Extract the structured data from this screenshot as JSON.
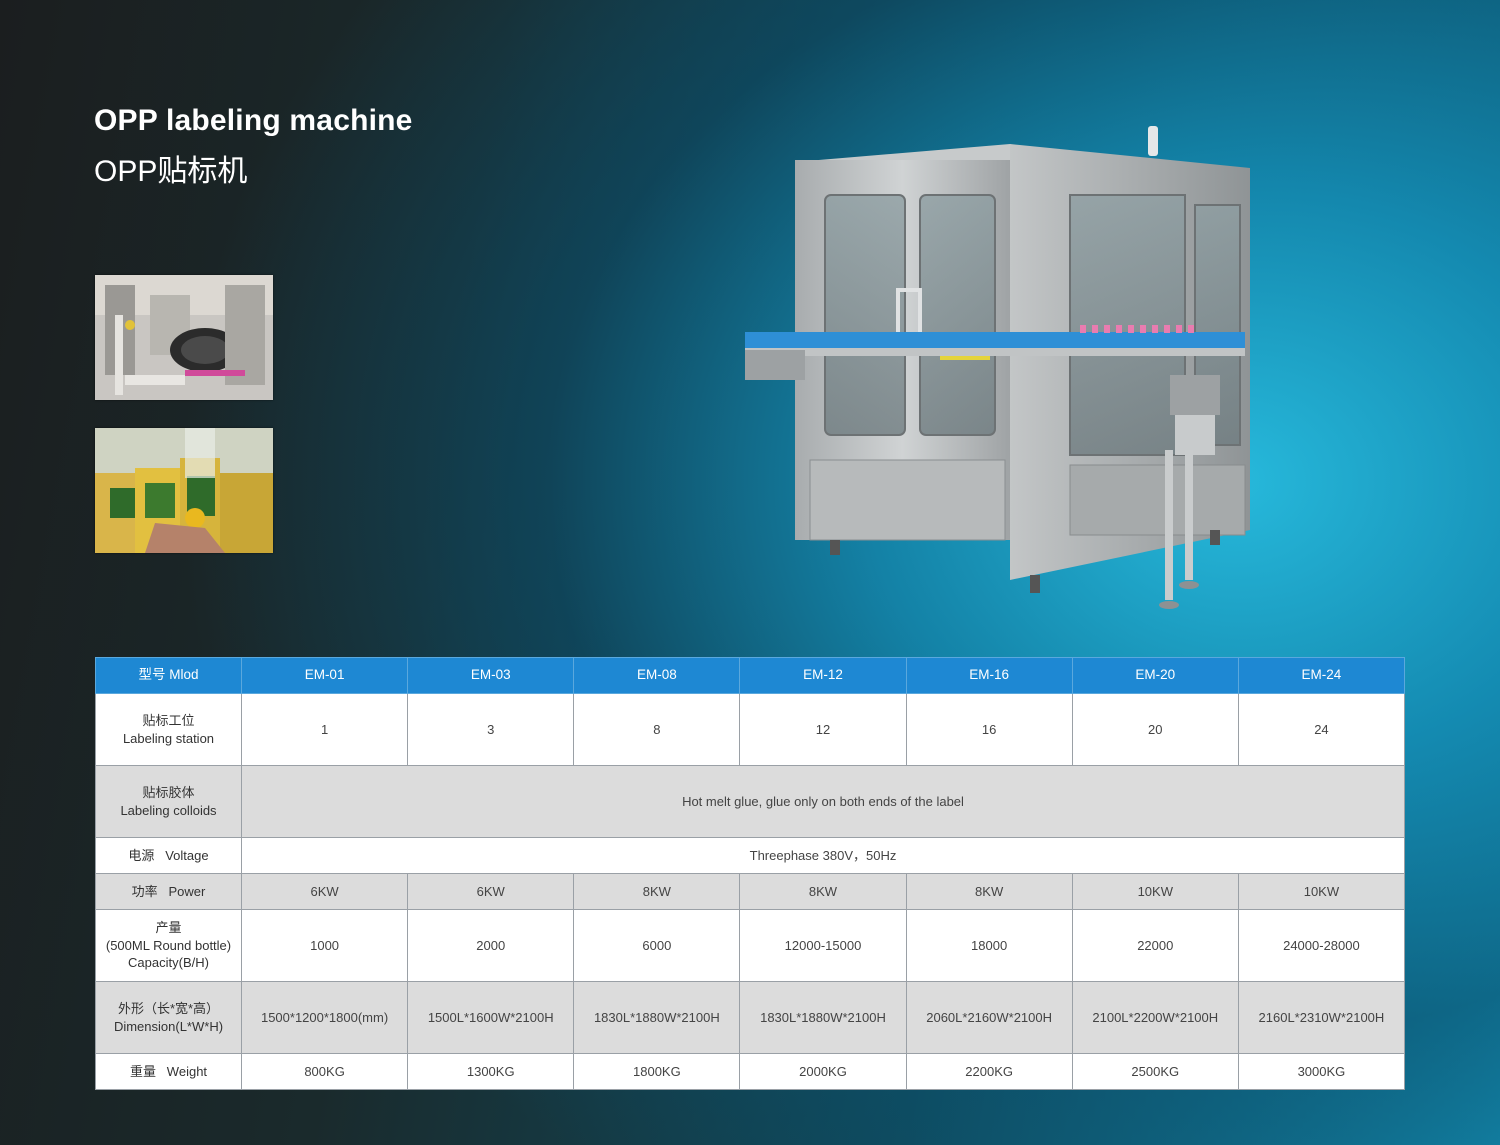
{
  "header": {
    "title_en": "OPP labeling machine",
    "title_cn": "OPP贴标机"
  },
  "thumbnails": [
    {
      "name": "labeling-station-photo"
    },
    {
      "name": "labeled-bottles-photo"
    }
  ],
  "table": {
    "header_label": "型号  Mlod",
    "models": [
      "EM-01",
      "EM-03",
      "EM-08",
      "EM-12",
      "EM-16",
      "EM-20",
      "EM-24"
    ],
    "rows": {
      "station": {
        "label_cn": "贴标工位",
        "label_en": "Labeling station",
        "values": [
          "1",
          "3",
          "8",
          "12",
          "16",
          "20",
          "24"
        ]
      },
      "colloids": {
        "label_cn": "贴标胶体",
        "label_en": "Labeling colloids",
        "value": "Hot melt glue, glue only on both ends of the label"
      },
      "voltage": {
        "label": "电源   Voltage",
        "value": "Threephase 380V，50Hz"
      },
      "power": {
        "label": "功率   Power",
        "values": [
          "6KW",
          "6KW",
          "8KW",
          "8KW",
          "8KW",
          "10KW",
          "10KW"
        ]
      },
      "capacity": {
        "label_cn": "产量",
        "label_en1": "(500ML Round bottle)",
        "label_en2": "Capacity(B/H)",
        "values": [
          "1000",
          "2000",
          "6000",
          "12000-15000",
          "18000",
          "22000",
          "24000-28000"
        ]
      },
      "dimension": {
        "label_cn": "外形（长*宽*高）",
        "label_en": "Dimension(L*W*H)",
        "values": [
          "1500*1200*1800(mm)",
          "1500L*1600W*2100H",
          "1830L*1880W*2100H",
          "1830L*1880W*2100H",
          "2060L*2160W*2100H",
          "2100L*2200W*2100H",
          "2160L*2310W*2100H"
        ]
      },
      "weight": {
        "label": "重量   Weight",
        "values": [
          "800KG",
          "1300KG",
          "1800KG",
          "2000KG",
          "2200KG",
          "2500KG",
          "3000KG"
        ]
      }
    }
  },
  "colors": {
    "header_blue": "#1e88d3",
    "row_grey": "#dcdcdc",
    "row_white": "#ffffff"
  }
}
